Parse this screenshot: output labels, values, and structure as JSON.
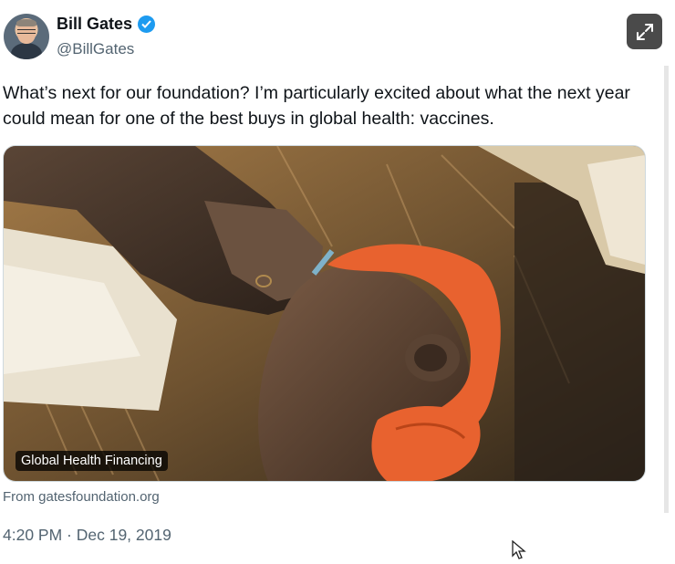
{
  "tweet": {
    "author": {
      "display_name": "Bill Gates",
      "handle": "@BillGates",
      "verified": true,
      "avatar_icon": "profile-photo"
    },
    "text": "What’s next for our foundation? I’m particularly excited about what the next year could mean for one of the best buys in global health: vaccines.",
    "media": {
      "label": "Global Health Financing",
      "source": "From gatesfoundation.org"
    },
    "timestamp": "4:20 PM · Dec 19, 2019"
  },
  "colors": {
    "verified_blue": "#1d9bf0",
    "secondary_text": "#536471",
    "headscarf_orange": "#e8622f"
  },
  "icons": {
    "verified": "verified-badge-icon",
    "expand": "expand-icon",
    "cursor": "mouse-cursor-icon"
  }
}
